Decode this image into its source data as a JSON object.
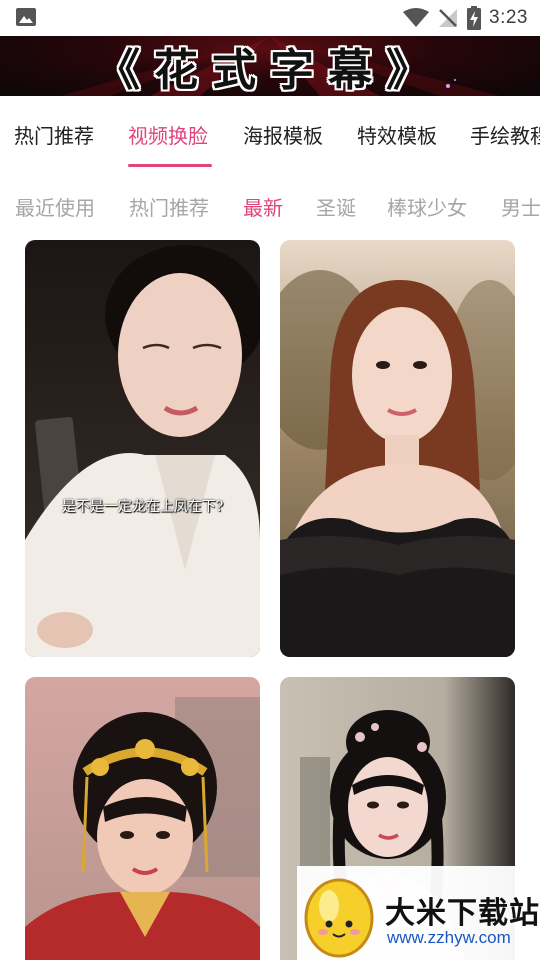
{
  "status_bar": {
    "time": "3:23",
    "icons": [
      "gallery-notification-icon",
      "wifi-icon",
      "signal-blocked-icon",
      "battery-charging-icon"
    ]
  },
  "banner": {
    "title": "《花式字幕》"
  },
  "tabs": [
    {
      "label": "热门推荐",
      "active": false
    },
    {
      "label": "视频换脸",
      "active": true
    },
    {
      "label": "海报模板",
      "active": false
    },
    {
      "label": "特效模板",
      "active": false
    },
    {
      "label": "手绘教程",
      "active": false
    }
  ],
  "subtabs": [
    {
      "label": "最近使用",
      "active": false
    },
    {
      "label": "热门推荐",
      "active": false
    },
    {
      "label": "最新",
      "active": true
    },
    {
      "label": "圣诞",
      "active": false
    },
    {
      "label": "棒球少女",
      "active": false
    },
    {
      "label": "男士",
      "active": false
    }
  ],
  "cards": [
    {
      "caption": "是不是一定龙在上凤在下?"
    },
    {
      "caption": ""
    },
    {
      "caption": ""
    },
    {
      "caption": ""
    }
  ],
  "watermark": {
    "name": "大米下载站",
    "url": "www.zzhyw.com"
  },
  "colors": {
    "accent": "#e0457d",
    "inactive_subtab": "#a6a6a6",
    "tab_text": "#222222"
  }
}
